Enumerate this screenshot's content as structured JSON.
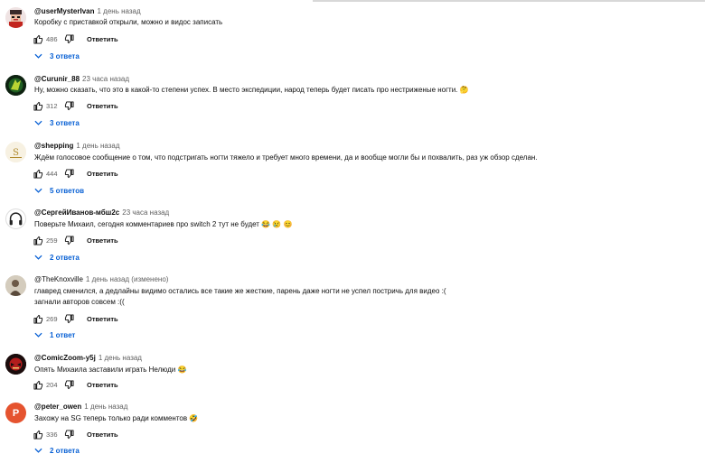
{
  "labels": {
    "reply": "Ответить"
  },
  "comments": [
    {
      "author": "@userMysterIvan",
      "time": "1 день назад",
      "text": "Коробку с приставкой открыли, можно и видос записать",
      "likes": "486",
      "replies": "3 ответа"
    },
    {
      "author": "@Curunir_88",
      "time": "23 часа назад",
      "text": "Ну, можно сказать, что это в какой-то степени успех. В место экспедиции, народ теперь будет писать про нестриженые ногти. 🤔",
      "likes": "312",
      "replies": "3 ответа"
    },
    {
      "author": "@shepping",
      "time": "1 день назад",
      "text": "Ждём голосовое сообщение о том, что подстригать ногти тяжело и требует много времени, да и вообще могли бы и похвалить, раз уж обзор сделан.",
      "likes": "444",
      "replies": "5 ответов"
    },
    {
      "author": "@СергейИванов-мбш2с",
      "time": "23 часа назад",
      "text": "Поверьте Михаил, сегодня комментариев про switch 2 тут не будет 😂 😢 😊",
      "likes": "259",
      "replies": "2 ответа"
    },
    {
      "author": "@TheKnoxville",
      "time": "1 день назад (изменено)",
      "text": "главред сменился, а дедлайны видимо остались все такие же жесткие, парень даже ногти не успел постричь для видео :(",
      "text2": "загнали авторов совсем :((",
      "likes": "269",
      "replies": "1 ответ"
    },
    {
      "author": "@ComicZoom-y5j",
      "time": "1 день назад",
      "text": "Опять Михаила заставили играть Нелюди 😂",
      "likes": "204"
    },
    {
      "author": "@peter_owen",
      "time": "1 день назад",
      "text": "Захожу на SG теперь только ради комментов 🤣",
      "likes": "336",
      "replies": "2 ответа",
      "avatar_letter": "P",
      "avatar_color": "#e5532f"
    }
  ]
}
